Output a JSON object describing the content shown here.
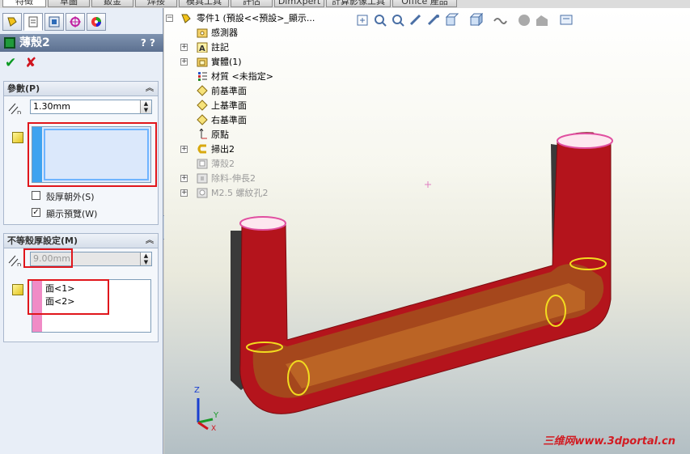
{
  "tabs": [
    {
      "label": "特徵",
      "active": true
    },
    {
      "label": "草圖",
      "active": false
    },
    {
      "label": "鈑金",
      "active": false
    },
    {
      "label": "焊接",
      "active": false
    },
    {
      "label": "模具工具",
      "active": false
    },
    {
      "label": "評估",
      "active": false
    },
    {
      "label": "DimXpert",
      "active": false
    },
    {
      "label": "計算影像工具",
      "active": false
    },
    {
      "label": "Office 產品",
      "active": false
    }
  ],
  "property_manager": {
    "title": "薄殼2",
    "help": "? ?",
    "ok_icon": "check-icon",
    "cancel_icon": "x-icon",
    "params": {
      "title": "參數(P)",
      "thickness": "1.30mm",
      "outward_label": "殼厚朝外(S)",
      "outward_checked": false,
      "preview_label": "顯示預覽(W)",
      "preview_checked": true
    },
    "multi": {
      "title": "不等殼厚設定(M)",
      "thickness": "9.00mm",
      "faces": [
        "面<1>",
        "面<2>"
      ]
    }
  },
  "tree": {
    "items": [
      {
        "label": "零件1 (預設<<預設>_顯示...",
        "icon": "part-icon",
        "expander": "",
        "dim": false
      },
      {
        "label": "感測器",
        "icon": "sensor-folder-icon",
        "expander": "",
        "dim": false
      },
      {
        "label": "註記",
        "icon": "annotation-icon",
        "expander": "+",
        "dim": false
      },
      {
        "label": "實體(1)",
        "icon": "solid-bodies-icon",
        "expander": "+",
        "dim": false
      },
      {
        "label": "材質 <未指定>",
        "icon": "material-icon",
        "expander": "",
        "dim": false
      },
      {
        "label": "前基準面",
        "icon": "plane-icon",
        "expander": "",
        "dim": false
      },
      {
        "label": "上基準面",
        "icon": "plane-icon",
        "expander": "",
        "dim": false
      },
      {
        "label": "右基準面",
        "icon": "plane-icon",
        "expander": "",
        "dim": false
      },
      {
        "label": "原點",
        "icon": "origin-icon",
        "expander": "",
        "dim": false
      },
      {
        "label": "掃出2",
        "icon": "sweep-icon",
        "expander": "+",
        "dim": false
      },
      {
        "label": "薄殼2",
        "icon": "shell-icon",
        "expander": "",
        "dim": true
      },
      {
        "label": "除料-伸長2",
        "icon": "cut-extrude-icon",
        "expander": "+",
        "dim": true
      },
      {
        "label": "M2.5 螺紋孔2",
        "icon": "hole-icon",
        "expander": "+",
        "dim": true
      }
    ]
  },
  "triad": {
    "z": "Z",
    "y": "Y",
    "x": "X"
  },
  "watermark": "三维网www.3dportal.cn",
  "colors": {
    "model_red": "#b4141c",
    "highlight_yellow": "#f2dc1f",
    "selection_red": "#e0161c",
    "pm_title_bg": "#6a7f9e"
  }
}
